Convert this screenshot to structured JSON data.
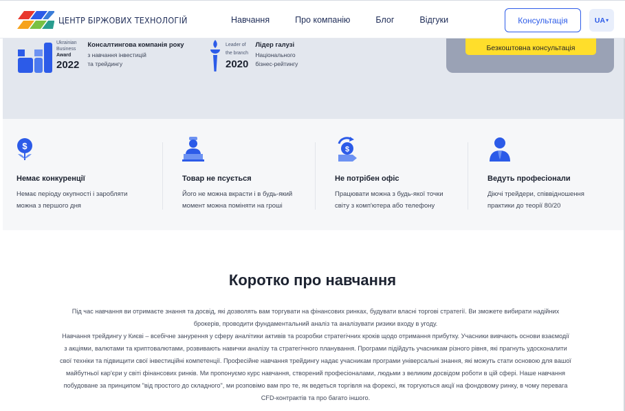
{
  "header": {
    "logo_text": "ЦЕНТР БІРЖОВИХ ТЕХНОЛОГІЙ",
    "nav": [
      "Навчання",
      "Про компанію",
      "Блог",
      "Відгуки"
    ],
    "consult_button": "Консультація",
    "lang": "UA"
  },
  "hero": {
    "award1": {
      "caption_lines": [
        "Ukrainian",
        "Business",
        "Award"
      ],
      "year": "2022",
      "title": "Консалтингова компанія року",
      "desc_lines": [
        "з навчання інвестицій",
        "та трейдингу"
      ]
    },
    "award2": {
      "caption_lines": [
        "Leader of",
        "the branch"
      ],
      "year": "2020",
      "title": "Лідер галузі",
      "desc_lines": [
        "Національного",
        "бізнес-рейтингу"
      ]
    },
    "cta_button": "Безкоштовна консультація"
  },
  "features": [
    {
      "icon": "dollar-flower-icon",
      "title": "Немає конкуренції",
      "text_lines": [
        "Немає періоду окупності і заробляти",
        "можна з першого дня"
      ]
    },
    {
      "icon": "laptop-user-icon",
      "title": "Товар не псується",
      "text_lines": [
        "Його не можна вкрасти і в будь-який",
        "момент можна поміняти на гроші"
      ]
    },
    {
      "icon": "money-exchange-icon",
      "title": "Не потрібен офіс",
      "text_lines": [
        "Працювати можна з будь-якої точки",
        "світу з комп'ютера або телефону"
      ]
    },
    {
      "icon": "professional-icon",
      "title": "Ведуть професіонали",
      "text_lines": [
        "Діючі трейдери, співвідношення",
        "практики до теорії 80/20"
      ]
    }
  ],
  "about": {
    "title": "Коротко про навчання",
    "lines": [
      "Під час навчання ви отримаєте знання та досвід, які дозволять вам торгувати на фінансових ринках, будувати власні торгові стратегії. Ви зможете вибирати надійних",
      "брокерів, проводити фундаментальний аналіз та аналізувати ризики входу в угоду.",
      "Навчання трейдингу у Києві – всебічне занурення у сферу аналітики активів та розробки стратегічних кроків щодо отримання прибутку. Учасники вивчають основи взаємодії",
      "з акціями, валютами та криптовалютами, розвивають навички аналізу та стратегічного планування. Програми підійдуть учасникам різного рівня, які прагнуть удосконалити",
      "свої техніки та підвищити свої інвестиційні компетенції. Професійне навчання трейдингу надає учасникам програми універсальні знання, які можуть стати основою для вашої",
      "майбутньої кар'єри у світі фінансових ринків. Ми пропонуємо курс навчання, створений професіоналами, людьми з великим досвідом роботи в цій сфері. Наше навчання",
      "побудоване за принципом \"від простого до складного\", ми розповімо вам про те, як ведеться торгівля на форексі, як торгуються акції на фондовому ринку, в чому перевага",
      "CFD-контрактів та про багато іншого."
    ]
  }
}
